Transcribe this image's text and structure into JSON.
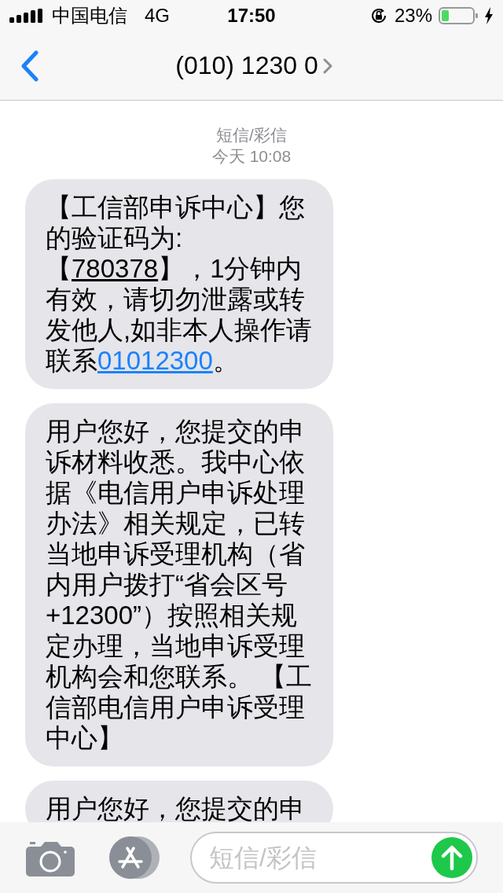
{
  "status_bar": {
    "carrier": "中国电信",
    "network": "4G",
    "time": "17:50",
    "battery": "23%"
  },
  "nav": {
    "title": "(010) 1230 0"
  },
  "thread_header": {
    "service": "短信/彩信",
    "time": "今天 10:08"
  },
  "messages": [
    {
      "parts": [
        {
          "kind": "text",
          "text": "【工信部申诉中心】您的验证码为:【"
        },
        {
          "kind": "code",
          "text": "780378"
        },
        {
          "kind": "text",
          "text": "】，1分钟内有效，请切勿泄露或转发他人,如非本人操作请联系"
        },
        {
          "kind": "link",
          "text": "01012300"
        },
        {
          "kind": "text",
          "text": "。"
        }
      ]
    },
    {
      "parts": [
        {
          "kind": "text",
          "text": "用户您好，您提交的申诉材料收悉。我中心依据《电信用户申诉处理办法》相关规定，已转当地申诉受理机构（省内用户拨打“省会区号+12300”）按照相关规定办理，当地申诉受理机构会和您联系。 【工信部电信用户申诉受理中心】"
        }
      ]
    },
    {
      "parts": [
        {
          "kind": "text",
          "text": "用户您好，您提交的申"
        }
      ]
    }
  ],
  "composer": {
    "placeholder": "短信/彩信"
  }
}
